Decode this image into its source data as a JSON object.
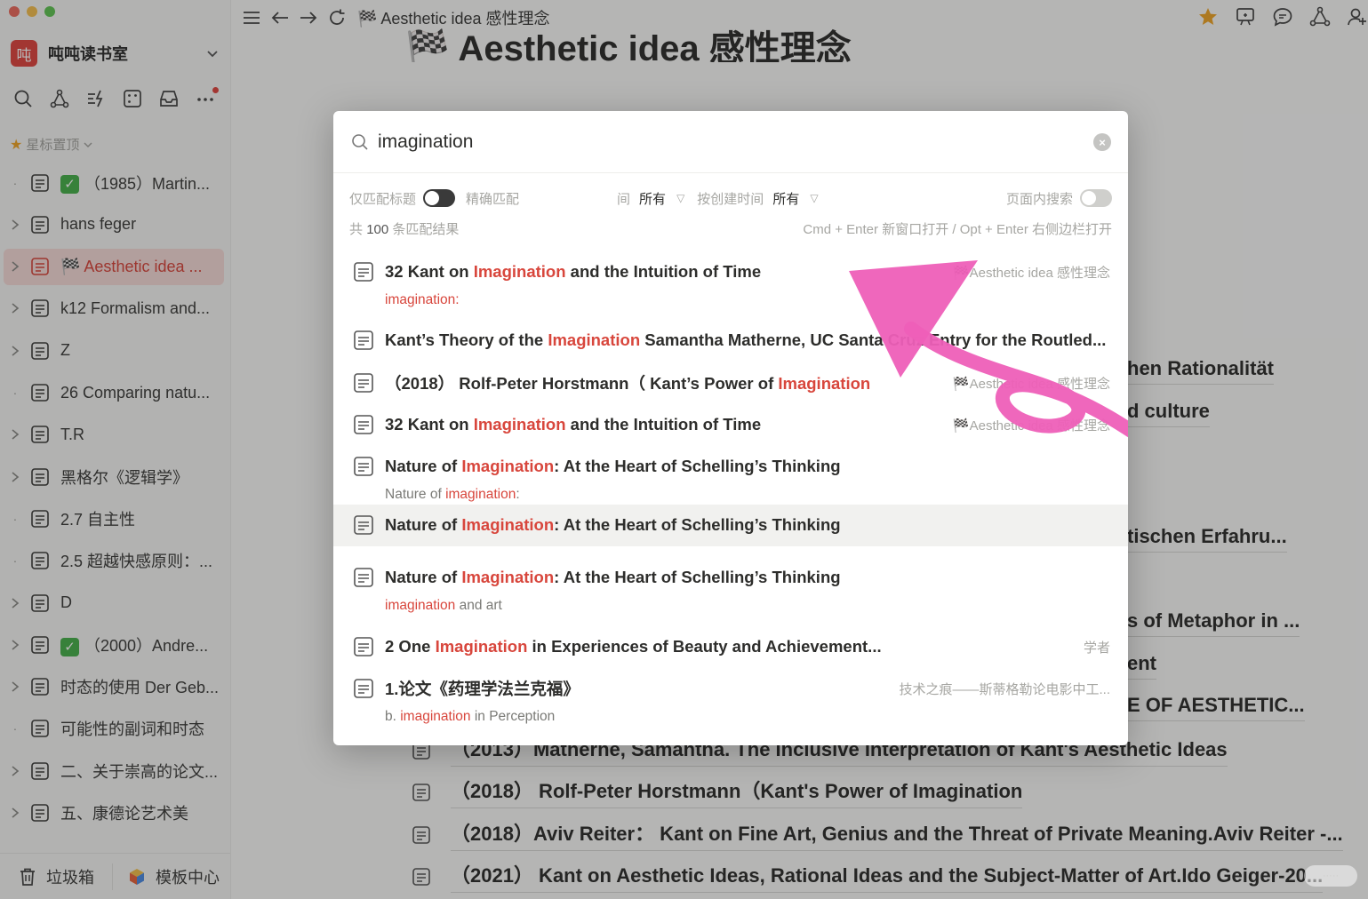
{
  "window": {
    "controls": [
      "#ed6a5e",
      "#f5bf4f",
      "#61c554"
    ]
  },
  "workspace": {
    "logo_char": "吨",
    "name": "吨吨读书室"
  },
  "sidebar": {
    "tools": [
      "search-icon",
      "graph-icon",
      "quick-capture-icon",
      "random-note-icon",
      "inbox-icon",
      "more-icon"
    ],
    "starred_header": "星标置顶",
    "items": [
      {
        "label": "（1985）Martin...",
        "checked": true,
        "lead": "dot"
      },
      {
        "label": "hans feger",
        "checked": false,
        "lead": "chevron"
      },
      {
        "label": "🏁 Aesthetic idea ...",
        "checked": false,
        "lead": "chevron",
        "active": true
      },
      {
        "label": "k12 Formalism and...",
        "checked": false,
        "lead": "chevron"
      },
      {
        "label": "Z",
        "checked": false,
        "lead": "chevron"
      },
      {
        "label": "26 Comparing natu...",
        "checked": false,
        "lead": "dot"
      },
      {
        "label": "T.R",
        "checked": false,
        "lead": "chevron"
      },
      {
        "label": "黑格尔《逻辑学》",
        "checked": false,
        "lead": "chevron"
      },
      {
        "label": "2.7 自主性",
        "checked": false,
        "lead": "dot"
      },
      {
        "label": "2.5 超越快感原则：...",
        "checked": false,
        "lead": "dot"
      },
      {
        "label": "D",
        "checked": false,
        "lead": "chevron"
      },
      {
        "label": "（2000）Andre...",
        "checked": true,
        "lead": "chevron"
      },
      {
        "label": "时态的使用 Der Geb...",
        "checked": false,
        "lead": "chevron"
      },
      {
        "label": "可能性的副词和时态",
        "checked": false,
        "lead": "dot"
      },
      {
        "label": "二、关于崇高的论文...",
        "checked": false,
        "lead": "chevron"
      },
      {
        "label": "五、康德论艺术美",
        "checked": false,
        "lead": "chevron"
      }
    ],
    "trash_label": "垃圾箱",
    "templates_label": "模板中心"
  },
  "topbar": {
    "title": "🏁 Aesthetic idea 感性理念",
    "right_icons": [
      "star-icon",
      "present-icon",
      "comment-icon",
      "graph-icon",
      "share-icon"
    ],
    "accent": "#f0a528"
  },
  "document": {
    "title": "🏁 Aesthetic idea 感性理念",
    "peeks": [
      "hen Rationalität",
      "d culture",
      "tischen Erfahru...",
      "s of Metaphor in ...",
      "ent",
      "E OF AESTHETIC..."
    ],
    "rows": [
      "（2013）Matherne, Samantha. The Inclusive Interpretation of Kant's Aesthetic Ideas",
      "（2018） Rolf-Peter Horstmann（Kant's Power of Imagination",
      "（2018）Aviv Reiter： Kant on Fine Art, Genius and the Threat of Private Meaning.Aviv Reiter -...",
      "（2021） Kant on Aesthetic Ideas, Rational Ideas and the Subject-Matter of Art.Ido Geiger-20..."
    ]
  },
  "search": {
    "query": "imagination",
    "filters": {
      "title_only_label": "仅匹配标题",
      "title_only_on": true,
      "exact_label": "精确匹配",
      "edit_time_label": "间",
      "edit_time_value": "所有",
      "created_label": "按创建时间",
      "created_value": "所有",
      "in_page_label": "页面内搜索",
      "in_page_on": false
    },
    "count_prefix": "共",
    "count": "100",
    "count_suffix": "条匹配结果",
    "shortcut_hint": "Cmd + Enter 新窗口打开 / Opt + Enter 右侧边栏打开",
    "results": [
      {
        "pre": "32 Kant on ",
        "match": "Imagination",
        "post": " and the Intuition of Time",
        "source": "🏁Aesthetic idea 感性理念",
        "snippet_pre": "",
        "snippet_match": "imagination:",
        "snippet_post": ""
      },
      {
        "pre": "Kant’s Theory of the ",
        "match": "Imagination",
        "post": " Samantha Matherne, UC Santa Cruz Entry for the Routled...",
        "source": "",
        "snippet_pre": "",
        "snippet_match": "",
        "snippet_post": ""
      },
      {
        "pre": "（2018） Rolf-Peter Horstmann（ Kant’s Power of ",
        "match": "Imagination",
        "post": "",
        "source": "🏁Aesthetic idea 感性理念",
        "snippet_pre": "",
        "snippet_match": "",
        "snippet_post": ""
      },
      {
        "pre": "32 Kant on ",
        "match": "Imagination",
        "post": " and the Intuition of Time",
        "source": "🏁Aesthetic idea 感性理念",
        "snippet_pre": "",
        "snippet_match": "",
        "snippet_post": ""
      },
      {
        "pre": "Nature of ",
        "match": "Imagination",
        "post": ": At the Heart of Schelling’s Thinking",
        "source": "",
        "snippet_pre": "Nature of ",
        "snippet_match": "imagination",
        "snippet_post": ":"
      },
      {
        "pre": "Nature of ",
        "match": "Imagination",
        "post": ": At the Heart of Schelling’s Thinking",
        "source": "",
        "snippet_pre": "",
        "snippet_match": "",
        "snippet_post": "",
        "highlighted": true
      },
      {
        "pre": "Nature of ",
        "match": "Imagination",
        "post": ": At the Heart of Schelling’s Thinking",
        "source": "",
        "snippet_pre": "",
        "snippet_match": "imagination",
        "snippet_post": " and art"
      },
      {
        "pre": "2 One ",
        "match": "Imagination",
        "post": " in Experiences of Beauty and Achievement...",
        "source": "学者",
        "snippet_pre": "",
        "snippet_match": "",
        "snippet_post": ""
      },
      {
        "pre": "1.论文《药理学法兰克福》",
        "match": "",
        "post": "",
        "source": "技术之痕——斯蒂格勒论电影中工...",
        "snippet_pre": "b. ",
        "snippet_match": "imagination",
        "snippet_post": " in Perception"
      }
    ]
  },
  "annotation": {
    "color": "#ee5fb8"
  }
}
